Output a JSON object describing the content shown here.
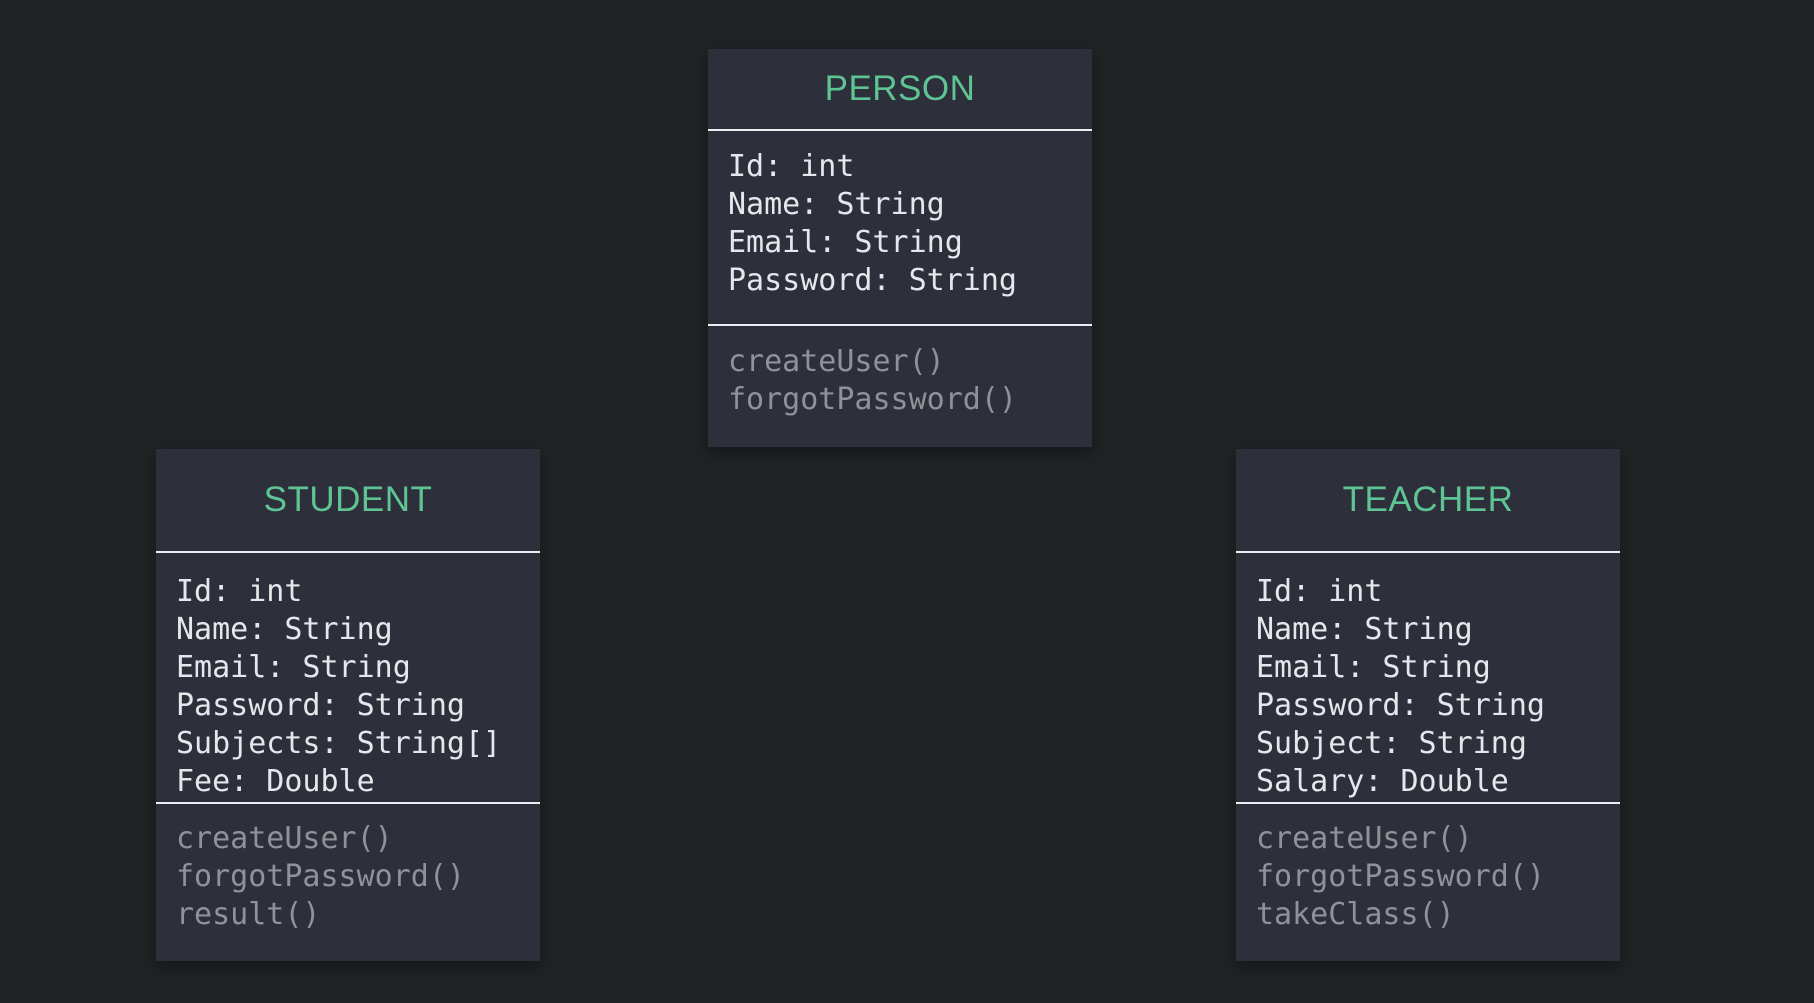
{
  "classes": {
    "person": {
      "name": "PERSON",
      "attributes": [
        "Id: int",
        "Name: String",
        "Email: String",
        "Password: String"
      ],
      "methods": [
        "createUser()",
        "forgotPassword()"
      ]
    },
    "student": {
      "name": "STUDENT",
      "attributes": [
        "Id: int",
        "Name: String",
        "Email: String",
        "Password: String",
        "Subjects: String[]",
        "Fee: Double"
      ],
      "methods": [
        "createUser()",
        "forgotPassword()",
        "result()"
      ]
    },
    "teacher": {
      "name": "TEACHER",
      "attributes": [
        "Id: int",
        "Name: String",
        "Email: String",
        "Password: String",
        "Subject: String",
        "Salary: Double"
      ],
      "methods": [
        "createUser()",
        "forgotPassword()",
        "takeClass()"
      ]
    }
  },
  "colors": {
    "background": "#1f2324",
    "box": "#2d2f3b",
    "title": "#5fc493",
    "attribute_text": "#e6e7ea",
    "method_text": "#8f9297",
    "divider": "#eceef0"
  }
}
